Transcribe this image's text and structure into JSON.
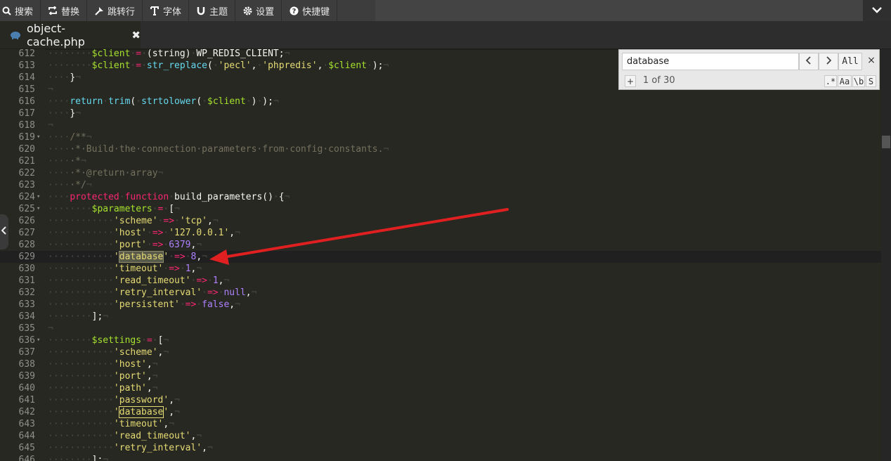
{
  "toolbar": {
    "items": [
      {
        "icon": "search-icon",
        "label": "搜索"
      },
      {
        "icon": "replace-icon",
        "label": "替换"
      },
      {
        "icon": "goto-line-icon",
        "label": "跳转行"
      },
      {
        "icon": "font-icon",
        "label": "字体"
      },
      {
        "icon": "theme-icon",
        "label": "主题"
      },
      {
        "icon": "gear-icon",
        "label": "设置"
      },
      {
        "icon": "help-icon",
        "label": "快捷键"
      }
    ],
    "collapse_icon": "chevron-down-icon"
  },
  "tab": {
    "file_icon": "php-elephant-icon",
    "label": "object-cache.php",
    "close_icon": "close-icon"
  },
  "search": {
    "value": "database",
    "prev_icon": "chevron-left-icon",
    "next_icon": "chevron-right-icon",
    "all_label": "All",
    "close_label": "×",
    "plus_label": "+",
    "count": "1 of 30",
    "regex_label": ".*",
    "case_label": "Aa",
    "word_label": "\\b",
    "selection_label": "S"
  },
  "editor": {
    "active_line": "629",
    "lines": [
      {
        "n": "612"
      },
      {
        "n": "613"
      },
      {
        "n": "614"
      },
      {
        "n": "615"
      },
      {
        "n": "616"
      },
      {
        "n": "617"
      },
      {
        "n": "618"
      },
      {
        "n": "619"
      },
      {
        "n": "620"
      },
      {
        "n": "621"
      },
      {
        "n": "622"
      },
      {
        "n": "623"
      },
      {
        "n": "624"
      },
      {
        "n": "625"
      },
      {
        "n": "626"
      },
      {
        "n": "627"
      },
      {
        "n": "628"
      },
      {
        "n": "629"
      },
      {
        "n": "630"
      },
      {
        "n": "631"
      },
      {
        "n": "632"
      },
      {
        "n": "633"
      },
      {
        "n": "634"
      },
      {
        "n": "635"
      },
      {
        "n": "636"
      },
      {
        "n": "637"
      },
      {
        "n": "638"
      },
      {
        "n": "639"
      },
      {
        "n": "640"
      },
      {
        "n": "641"
      },
      {
        "n": "642"
      },
      {
        "n": "643"
      },
      {
        "n": "644"
      },
      {
        "n": "645"
      },
      {
        "n": "646"
      }
    ]
  },
  "colors": {
    "background": "#272822",
    "keyword": "#f92672",
    "function": "#66d9ef",
    "variable": "#a6e22e",
    "string": "#e6db74",
    "number": "#ae81ff",
    "comment": "#75715e",
    "arrow": "#e02020"
  }
}
